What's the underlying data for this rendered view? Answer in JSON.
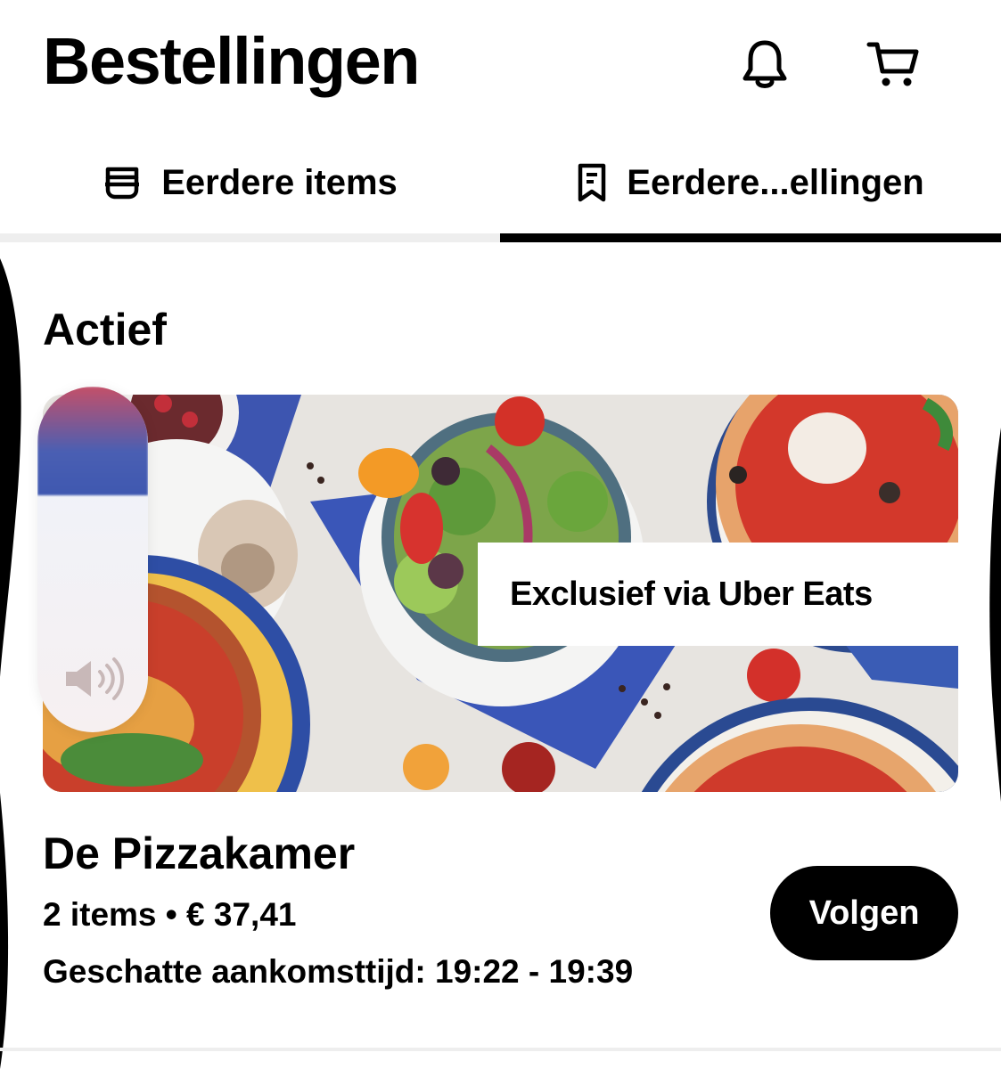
{
  "header": {
    "title": "Bestellingen",
    "icons": [
      "bell-icon",
      "cart-icon"
    ]
  },
  "tabs": [
    {
      "label": "Eerdere items",
      "icon": "basket-icon",
      "selected": false
    },
    {
      "label": "Eerdere...ellingen",
      "icon": "receipt-icon",
      "selected": true
    }
  ],
  "section": {
    "title": "Actief"
  },
  "banner": {
    "promo_label": "Exclusief via Uber Eats"
  },
  "order": {
    "restaurant": "De Pizzakamer",
    "summary": "2 items • € 37,41",
    "eta": "Geschatte aankomsttijd: 19:22 - 19:39",
    "follow_label": "Volgen"
  },
  "overlay": {
    "type": "volume-indicator",
    "icon": "speaker-icon"
  },
  "colors": {
    "accent": "#000000",
    "background": "#ffffff",
    "tab_inactive_line": "#eeeeee"
  }
}
